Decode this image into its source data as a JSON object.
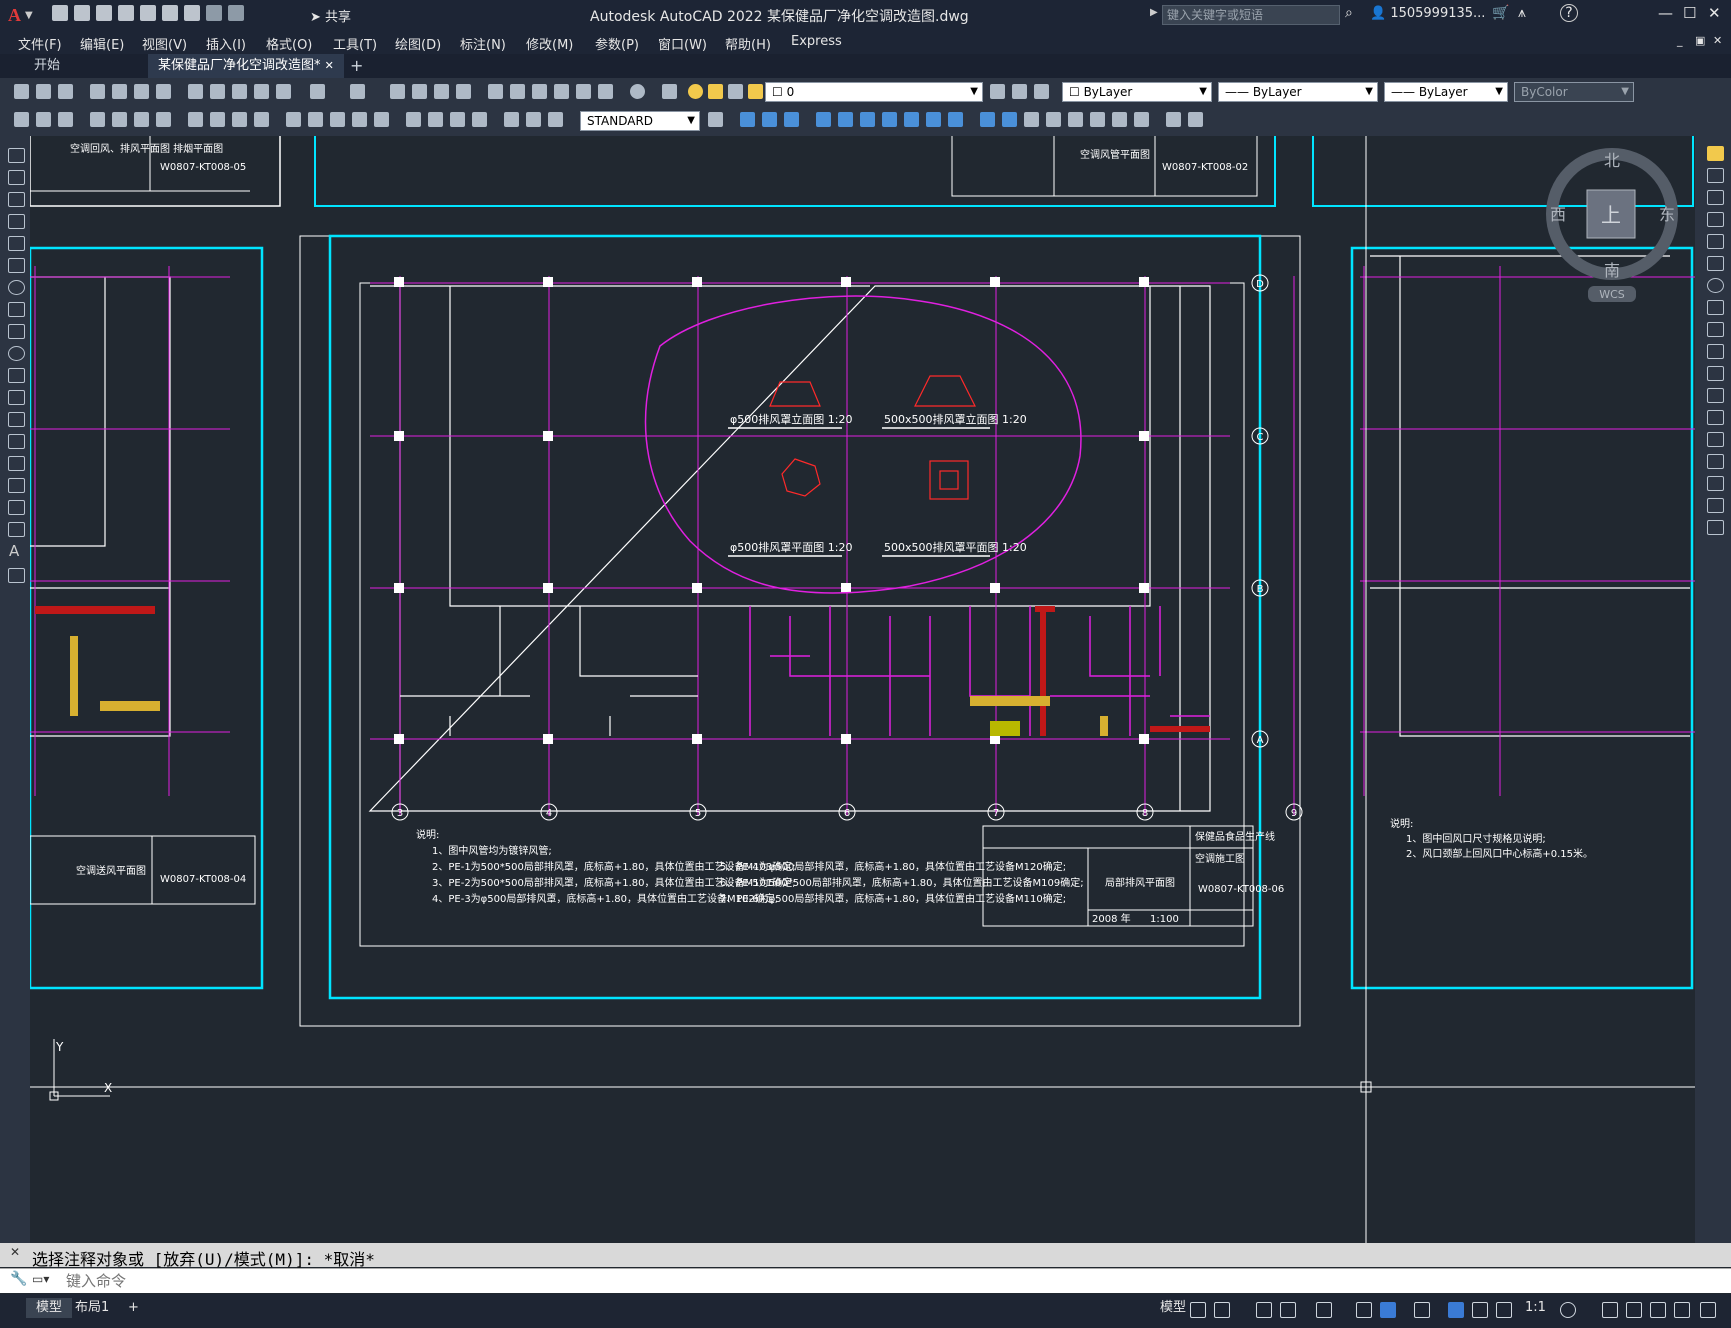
{
  "app": {
    "logo": "A",
    "title": "Autodesk AutoCAD 2022    某保健品厂净化空调改造图.dwg",
    "share_label": "共享",
    "search_placeholder": "键入关键字或短语",
    "user": "1505999135...",
    "help": "?"
  },
  "menu": [
    "文件(F)",
    "编辑(E)",
    "视图(V)",
    "插入(I)",
    "格式(O)",
    "工具(T)",
    "绘图(D)",
    "标注(N)",
    "修改(M)",
    "参数(P)",
    "窗口(W)",
    "帮助(H)",
    "Express"
  ],
  "tabs": [
    {
      "label": "开始",
      "active": false
    },
    {
      "label": "某保健品厂净化空调改造图*",
      "active": true
    }
  ],
  "toolbar": {
    "layer_value": "0",
    "color_value": "ByLayer",
    "linetype_value": "ByLayer",
    "lineweight_value": "ByLayer",
    "plotstyle_value": "ByColor",
    "textstyle_value": "STANDARD"
  },
  "viewcube": {
    "north": "北",
    "south": "南",
    "east": "东",
    "west": "西",
    "face": "上",
    "wcs": "WCS"
  },
  "canvas": {
    "grid_top": [
      "D",
      "C",
      "B",
      "A"
    ],
    "grid_bottom": [
      "3",
      "4",
      "5",
      "6",
      "7",
      "8",
      "9"
    ],
    "detail_labels": [
      "φ500排风罩立面图 1:20",
      "500x500排风罩立面图 1:20",
      "φ500排风罩平面图 1:20",
      "500x500排风罩平面图 1:20"
    ],
    "notes_title": "说明:",
    "notes": [
      "1、图中风管均为镀锌风管;",
      "2、PE-1为500*500局部排风罩，底标高+1.80，具体位置由工艺设备M103确定;",
      "3、PE-2为500*500局部排风罩，底标高+1.80，具体位置由工艺设备M101确定;",
      "4、PE-3为φ500局部排风罩，底标高+1.80，具体位置由工艺设备M102确定;",
      "5、PE-4为φ500局部排风罩，底标高+1.80，具体位置由工艺设备M120确定;",
      "6、PE-5为500*500局部排风罩，底标高+1.80，具体位置由工艺设备M109确定;",
      "7、PE-6为φ500局部排风罩，底标高+1.80，具体位置由工艺设备M110确定;"
    ],
    "title_block_main": {
      "name": "局部排风平面图",
      "code": "W0807-KT008-06",
      "project": "保健品食品生产线",
      "stage": "空调施工图",
      "year": "2008 年",
      "scale": "1:100"
    },
    "title_block_top": {
      "name": "空调风管平面图",
      "code": "W0807-KT008-02"
    },
    "title_block_topleft": {
      "name": "空调回风、排风平面图 排烟平面图",
      "code": "W0807-KT008-05"
    },
    "title_block_left": {
      "name": "空调送风平面图",
      "code": "W0807-KT008-04"
    },
    "right_notes": [
      "说明:",
      "1、图中回风口尺寸规格见说明;",
      "2、风口颈部上回风口中心标高+0.15米。"
    ],
    "ucs_y": "Y",
    "ucs_x": "X"
  },
  "command": {
    "history": "选择注释对象或 [放弃(U)/模式(M)]: *取消*",
    "placeholder": "键入命令"
  },
  "status": {
    "tabs": [
      {
        "label": "模型",
        "active": true
      },
      {
        "label": "布局1",
        "active": false
      }
    ],
    "model_label": "模型",
    "scale": "1:1",
    "plus": "+"
  }
}
